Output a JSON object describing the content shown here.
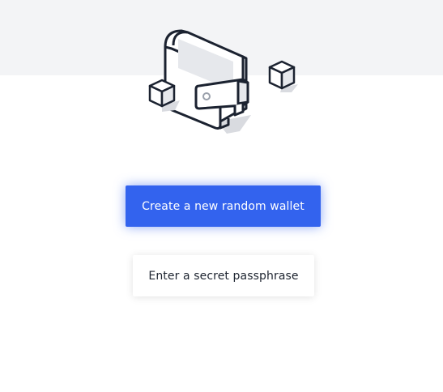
{
  "actions": {
    "create_wallet_label": "Create a new random wallet",
    "passphrase_label": "Enter a secret passphrase"
  },
  "colors": {
    "primary_button": "#3363ee",
    "top_band": "#f3f4f6",
    "outline": "#1b2230"
  },
  "icons": {
    "hero": "wallet-illustration-icon",
    "cube_left": "cube-icon",
    "cube_right": "cube-icon"
  }
}
